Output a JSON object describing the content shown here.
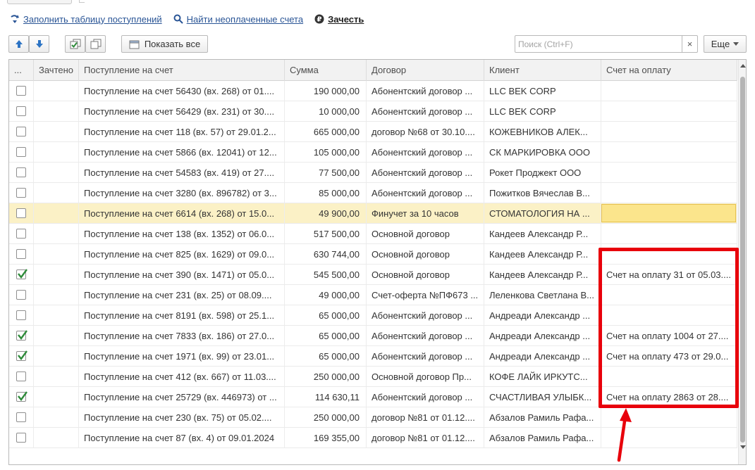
{
  "commands": {
    "fill_label": "Заполнить таблицу поступлений",
    "find_label": "Найти неоплаченные счета",
    "offset_label": "Зачесть"
  },
  "toolbar": {
    "show_all_label": "Показать все",
    "search_placeholder": "Поиск (Ctrl+F)",
    "clear_symbol": "×",
    "more_label": "Еще"
  },
  "table": {
    "headers": [
      "...",
      "Зачтено",
      "Поступление на счет",
      "Сумма",
      "Договор",
      "Клиент",
      "Счет на оплату"
    ],
    "rows": [
      {
        "checked": false,
        "receipt": "Поступление на счет 56430 (вх. 268) от 01....",
        "sum": "190 000,00",
        "contract": "Абонентский договор ...",
        "client": "LLC BEK CORP",
        "invoice": ""
      },
      {
        "checked": false,
        "receipt": "Поступление на счет 56429 (вх. 231) от 30....",
        "sum": "10 000,00",
        "contract": "Абонентский договор ...",
        "client": "LLC BEK CORP",
        "invoice": ""
      },
      {
        "checked": false,
        "receipt": "Поступление на счет 118 (вх. 57) от 29.01.2...",
        "sum": "665 000,00",
        "contract": "договор №68 от 30.10....",
        "client": "КОЖЕВНИКОВ АЛЕК...",
        "invoice": ""
      },
      {
        "checked": false,
        "receipt": "Поступление на счет 5866 (вх. 12041) от 12...",
        "sum": "105 000,00",
        "contract": "Абонентский договор ...",
        "client": "СК МАРКИРОВКА ООО",
        "invoice": ""
      },
      {
        "checked": false,
        "receipt": "Поступление на счет 54583 (вх. 419) от 27....",
        "sum": "77 500,00",
        "contract": "Абонентский договор ...",
        "client": "Рокет Проджект ООО",
        "invoice": ""
      },
      {
        "checked": false,
        "receipt": "Поступление на счет 3280 (вх. 896782) от 3...",
        "sum": "85 000,00",
        "contract": "Абонентский договор ...",
        "client": "Пожитков Вячеслав В...",
        "invoice": ""
      },
      {
        "checked": false,
        "receipt": "Поступление на счет 6614 (вх. 268) от 15.0...",
        "sum": "49 900,00",
        "contract": "Финучет за 10 часов",
        "client": "СТОМАТОЛОГИЯ НА ...",
        "invoice": "",
        "selected": true
      },
      {
        "checked": false,
        "receipt": "Поступление на счет 138 (вх. 1352) от 06.0...",
        "sum": "517 500,00",
        "contract": "Основной договор",
        "client": "Кандеев Александр Р...",
        "invoice": ""
      },
      {
        "checked": false,
        "receipt": "Поступление на счет 825 (вх. 1629) от 09.0...",
        "sum": "630 744,00",
        "contract": "Основной договор",
        "client": "Кандеев Александр Р...",
        "invoice": ""
      },
      {
        "checked": true,
        "receipt": "Поступление на счет 390 (вх. 1471) от 05.0...",
        "sum": "545 500,00",
        "contract": "Основной договор",
        "client": "Кандеев Александр Р...",
        "invoice": "Счет на оплату 31 от 05.03...."
      },
      {
        "checked": false,
        "receipt": "Поступление на счет 231 (вх. 25) от 08.09....",
        "sum": "49 000,00",
        "contract": "Счет-оферта №ПФ673 ...",
        "client": "Леленкова Светлана В...",
        "invoice": ""
      },
      {
        "checked": false,
        "receipt": "Поступление на счет 8191 (вх. 598) от 25.1...",
        "sum": "65 000,00",
        "contract": "Абонентский договор ...",
        "client": "Андреади Александр ...",
        "invoice": ""
      },
      {
        "checked": true,
        "receipt": "Поступление на счет 7833 (вх. 186) от 27.0...",
        "sum": "65 000,00",
        "contract": "Абонентский договор ...",
        "client": "Андреади Александр ...",
        "invoice": "Счет на оплату 1004 от 27...."
      },
      {
        "checked": true,
        "receipt": "Поступление на счет 1971 (вх. 99) от 23.01...",
        "sum": "65 000,00",
        "contract": "Абонентский договор ...",
        "client": "Андреади Александр ...",
        "invoice": "Счет на оплату 473 от 29.0..."
      },
      {
        "checked": false,
        "receipt": "Поступление на счет 412 (вх. 667) от 11.03....",
        "sum": "250 000,00",
        "contract": "Основной договор Пр...",
        "client": "КОФЕ ЛАЙК ИРКУТС...",
        "invoice": ""
      },
      {
        "checked": true,
        "receipt": "Поступление на счет 25729 (вх. 446973) от ...",
        "sum": "114 630,11",
        "contract": "Абонентский договор ...",
        "client": "СЧАСТЛИВАЯ УЛЫБК...",
        "invoice": "Счет на оплату 2863 от 28...."
      },
      {
        "checked": false,
        "receipt": "Поступление на счет 230 (вх. 75) от 05.02....",
        "sum": "250 000,00",
        "contract": "договор №81 от 01.12....",
        "client": "Абзалов Рамиль Рафа...",
        "invoice": ""
      },
      {
        "checked": false,
        "receipt": "Поступление на счет 87 (вх. 4) от 09.01.2024",
        "sum": "169 355,00",
        "contract": "договор №81 от 01.12....",
        "client": "Абзалов Рамиль Рафа...",
        "invoice": ""
      }
    ]
  },
  "annotation_color": "#e8000b",
  "selection_color": "#fbf1c6",
  "checkbox_color": "#2e8b3a"
}
